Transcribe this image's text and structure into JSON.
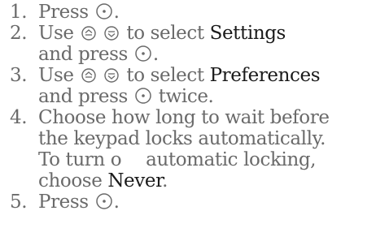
{
  "steps": [
    {
      "number": "1.",
      "text_a": "Press",
      "text_b": "."
    },
    {
      "number": "2.",
      "text_a": "Use",
      "text_b": "to select",
      "keyword": "Settings",
      "text_c": "and press",
      "text_d": "."
    },
    {
      "number": "3.",
      "text_a": "Use",
      "text_b": "to select",
      "keyword": "Preferences",
      "text_c": "and press",
      "text_d": "twice."
    },
    {
      "number": "4.",
      "line1": "Choose how long to wait before",
      "line2": "the keypad locks automatically.",
      "line3_a": "To turn o",
      "line3_b": "automatic locking,",
      "line4_a": "choose",
      "keyword": "Never",
      "line4_b": "."
    },
    {
      "number": "5.",
      "text_a": "Press",
      "text_b": "."
    }
  ],
  "icons": {
    "select": "select-key-icon",
    "up": "scroll-up-icon",
    "down": "scroll-down-icon"
  },
  "colors": {
    "text": "#6a6a6a",
    "keyword": "#1a1a1a"
  }
}
